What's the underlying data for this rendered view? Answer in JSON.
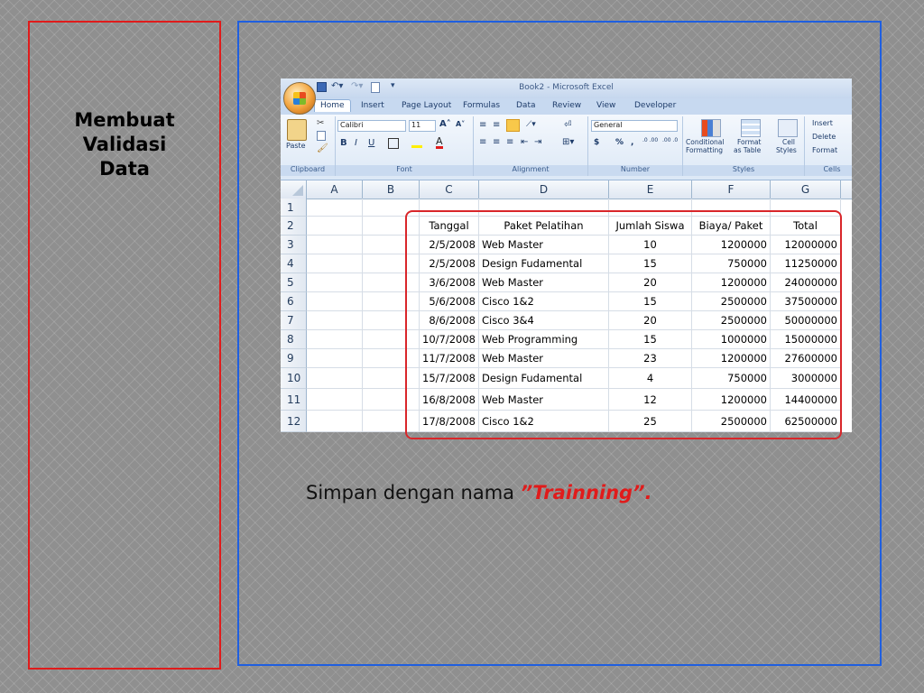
{
  "slide": {
    "left_title": "Membuat\nValidasi\nData",
    "caption_prefix": "Simpan dengan nama ",
    "caption_name": "”Trainning”."
  },
  "excel": {
    "window_title": "Book2 - Microsoft Excel",
    "tabs": [
      "Home",
      "Insert",
      "Page Layout",
      "Formulas",
      "Data",
      "Review",
      "View",
      "Developer"
    ],
    "ribbon": {
      "clipboard": {
        "paste_label": "Paste",
        "group_label": "Clipboard"
      },
      "font": {
        "font_name": "Calibri",
        "font_size": "11",
        "bold": "B",
        "italic": "I",
        "underline": "U",
        "group_label": "Font"
      },
      "alignment": {
        "group_label": "Alignment"
      },
      "number": {
        "format": "General",
        "currency": "$",
        "percent": "%",
        "comma": ",",
        "inc_decimal": ".0 .00",
        "dec_decimal": ".00 .0",
        "group_label": "Number"
      },
      "styles": {
        "conditional_line1": "Conditional",
        "conditional_line2": "Formatting",
        "format_line1": "Format",
        "format_line2": "as Table",
        "cell_line1": "Cell",
        "cell_line2": "Styles",
        "group_label": "Styles"
      },
      "cells": {
        "insert": "Insert",
        "delete": "Delete",
        "format": "Format",
        "group_label": "Cells"
      }
    },
    "columns": [
      "A",
      "B",
      "C",
      "D",
      "E",
      "F",
      "G"
    ],
    "rows": [
      "1",
      "2",
      "3",
      "4",
      "5",
      "6",
      "7",
      "8",
      "9",
      "10",
      "11",
      "12"
    ],
    "table": {
      "headers": [
        "Tanggal",
        "Paket Pelatihan",
        "Jumlah Siswa",
        "Biaya/ Paket",
        "Total"
      ],
      "data": [
        [
          "2/5/2008",
          "Web Master",
          "10",
          "1200000",
          "12000000"
        ],
        [
          "2/5/2008",
          "Design Fudamental",
          "15",
          "750000",
          "11250000"
        ],
        [
          "3/6/2008",
          "Web Master",
          "20",
          "1200000",
          "24000000"
        ],
        [
          "5/6/2008",
          "Cisco 1&2",
          "15",
          "2500000",
          "37500000"
        ],
        [
          "8/6/2008",
          "Cisco 3&4",
          "20",
          "2500000",
          "50000000"
        ],
        [
          "10/7/2008",
          "Web Programming",
          "15",
          "1000000",
          "15000000"
        ],
        [
          "11/7/2008",
          "Web Master",
          "23",
          "1200000",
          "27600000"
        ],
        [
          "15/7/2008",
          "Design Fudamental",
          "4",
          "750000",
          "3000000"
        ],
        [
          "16/8/2008",
          "Web Master",
          "12",
          "1200000",
          "14400000"
        ],
        [
          "17/8/2008",
          "Cisco 1&2",
          "25",
          "2500000",
          "62500000"
        ]
      ]
    }
  }
}
